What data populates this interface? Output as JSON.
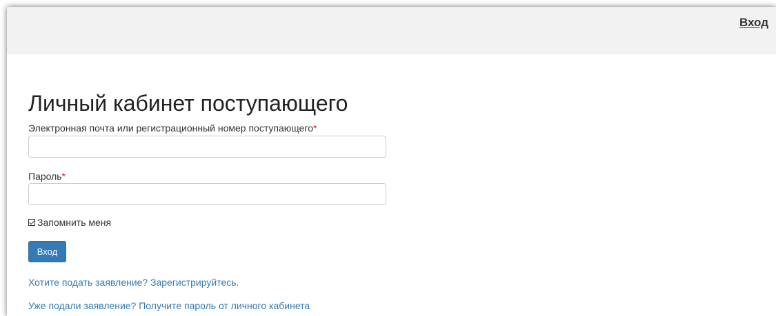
{
  "header": {
    "login_link": "Вход"
  },
  "main": {
    "title": "Личный кабинет поступающего",
    "email_field": {
      "label": "Электронная почта или регистрационный номер поступающего",
      "required_mark": "*",
      "value": "",
      "placeholder": ""
    },
    "password_field": {
      "label": "Пароль",
      "required_mark": "*",
      "value": "",
      "placeholder": ""
    },
    "remember_me": {
      "label": "Запомнить меня",
      "checked": true
    },
    "submit_label": "Вход",
    "register_link": "Хотите подать заявление? Зарегистрируйтесь.",
    "get_password_link": "Уже подали заявление? Получите пароль от личного кабинета"
  },
  "colors": {
    "header_bg": "#f2f2f2",
    "primary": "#337ab7",
    "required": "#d9232d",
    "text": "#333333"
  }
}
